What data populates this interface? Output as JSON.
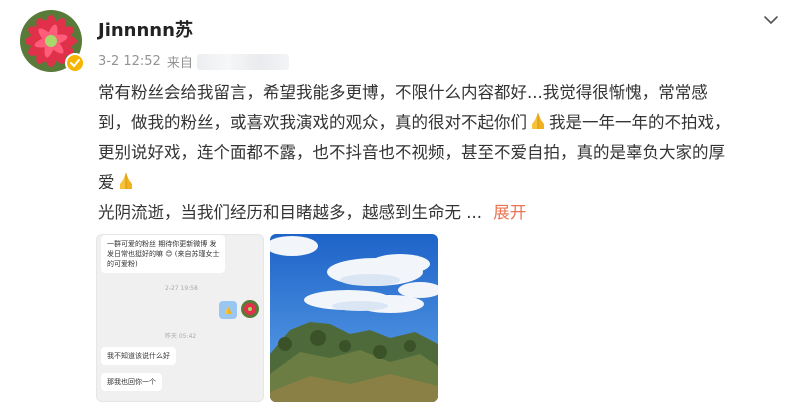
{
  "post": {
    "username": "Jinnnnn苏",
    "timestamp": "3-2 12:52",
    "source_prefix": "来自",
    "lines": [
      "常有粉丝会给我留言，希望我能多更博，不限什么内容都好...我觉得很惭愧，常常感",
      "到，做我的粉丝，或喜欢我演戏的观众，真的很对不起你们",
      "我是一年一年的不拍戏，",
      "更别说好戏，连个面都不露，也不抖音也不视频，甚至不爱自拍，真的是辜负大家的厚",
      "爱",
      "光阴流逝，当我们经历和目睹越多，越感到生命无",
      " ... ",
      "展开"
    ]
  },
  "chat": {
    "msg1_lines": [
      "一群可爱的粉丝 期待你更新微博 发",
      "发日常也挺好的嘛 😊 (来自苏瑾女士",
      "的可爱粉)"
    ],
    "time1": "2-27 19:58",
    "time2": "昨天 05:42",
    "msg2": "我不知道该说什么好",
    "msg3": "那我也回你一个"
  },
  "icons": {
    "avatar": "red-flower-avatar",
    "verified": "verified-badge-icon",
    "chevron": "chevron-down-icon",
    "pray": "folded-hands-emoji"
  },
  "colors": {
    "accent": "#eb7350",
    "verified": "#f7b500",
    "meta": "#939393"
  }
}
